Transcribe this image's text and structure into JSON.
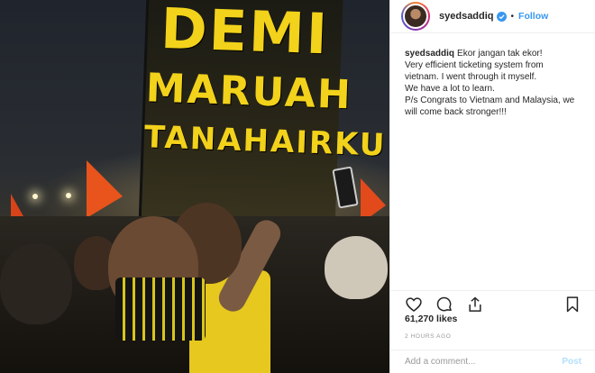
{
  "post": {
    "banner_lines": [
      "DEMI",
      "MARUAH",
      "TANAHAIRKU"
    ]
  },
  "header": {
    "username": "syedsaddiq",
    "separator": "•",
    "follow_label": "Follow"
  },
  "caption": {
    "username": "syedsaddiq",
    "lines": [
      "Ekor jangan tak ekor!",
      "Very efficient ticketing system from",
      "vietnam. I went through it myself.",
      "We have a lot to learn.",
      "P/s Congrats to Vietnam and Malaysia, we",
      "will come back stronger!!!"
    ]
  },
  "actions": {
    "icons": [
      "heart-icon",
      "comment-icon",
      "share-icon",
      "bookmark-icon"
    ]
  },
  "likes": "61,270 likes",
  "timestamp": "2 HOURS AGO",
  "comment": {
    "placeholder": "Add a comment...",
    "post_label": "Post"
  },
  "colors": {
    "follow_blue": "#3897f0",
    "verified_blue": "#3897f0",
    "banner_yellow": "#f2d21a",
    "post_disabled": "#b2dffc"
  }
}
